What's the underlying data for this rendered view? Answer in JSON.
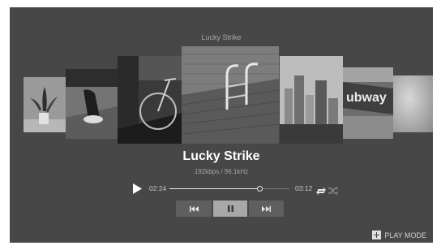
{
  "player": {
    "header_title": "Lucky Strike",
    "track_title": "Lucky Strike",
    "track_info": "192kbps / 96.1kHz",
    "elapsed": "02:24",
    "duration": "03:12",
    "progress_fraction": 0.75,
    "controls": {
      "play_icon": "play-icon",
      "prev_icon": "skip-previous-icon",
      "pause_icon": "pause-icon",
      "next_icon": "skip-next-icon",
      "repeat_icon": "repeat-icon",
      "shuffle_icon": "shuffle-icon"
    },
    "play_mode_label": "PLAY MODE",
    "album_covers": [
      {
        "name": "plant-cover"
      },
      {
        "name": "figure-on-grass-cover"
      },
      {
        "name": "bicycle-cover"
      },
      {
        "name": "pool-ladder-cover"
      },
      {
        "name": "city-skyline-cover"
      },
      {
        "name": "subway-sign-cover"
      },
      {
        "name": "blurred-cover"
      }
    ],
    "subway_sign_text": "ubway"
  },
  "colors": {
    "background": "#474747",
    "text": "#ffffff",
    "muted_text": "#a5a5a5",
    "button": "#5f5f5f",
    "button_active": "#a8a8a8"
  }
}
